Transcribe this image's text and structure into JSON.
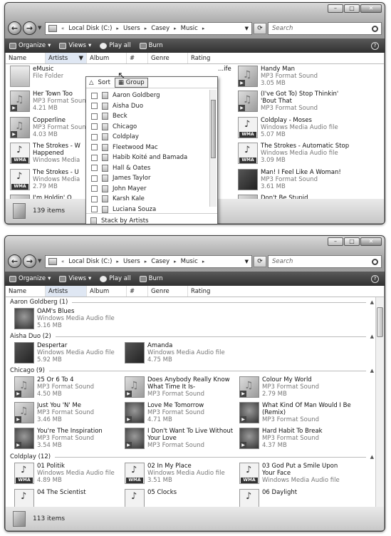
{
  "top": {
    "address": [
      "Local Disk (C:)",
      "Users",
      "Casey",
      "Music"
    ],
    "search_placeholder": "Search",
    "toolbar": {
      "organize": "Organize",
      "views": "Views",
      "play_all": "Play all",
      "burn": "Burn"
    },
    "columns": [
      "Name",
      "Artists",
      "Album",
      "#",
      "Genre",
      "Rating"
    ],
    "items": [
      {
        "name": "eMusic",
        "type": "File Folder",
        "size": "",
        "icon": "folder"
      },
      {
        "name": "Her Town Too",
        "type": "MP3 Format Sound",
        "size": "4.21 MB",
        "icon": "mp3"
      },
      {
        "name": "Copperline",
        "type": "MP3 Format Sound",
        "size": "4.03 MB",
        "icon": "mp3"
      },
      {
        "name": "The Strokes - W",
        "name2": "Happened",
        "type": "Windows Media",
        "size": "",
        "icon": "wma"
      },
      {
        "name": "The Strokes - U",
        "type": "Windows Media",
        "size": "2.79 MB",
        "icon": "wma"
      },
      {
        "name": "Handy Man",
        "type": "MP3 Format Sound",
        "size": "3.05 MB",
        "icon": "mp3"
      },
      {
        "name": "(I've Got To) Stop Thinkin'",
        "name2": "'Bout That",
        "type": "MP3 Format Sound",
        "size": "",
        "icon": "mp3"
      },
      {
        "name": "Coldplay - Moses",
        "type": "Windows Media Audio file",
        "size": "5.07 MB",
        "icon": "wma"
      },
      {
        "name": "The Strokes - Automatic Stop",
        "type": "Windows Media Audio file",
        "size": "3.09 MB",
        "icon": "wma"
      },
      {
        "name": "Man! I Feel Like A Woman!",
        "type": "MP3 Format Sound",
        "size": "3.61 MB",
        "icon": "photo"
      },
      {
        "name": "I'm Holdin' O",
        "type": "",
        "size": "",
        "icon": "mp3"
      },
      {
        "name": "...ife",
        "type": "",
        "size": "",
        "icon": ""
      },
      {
        "name": "Don't Be Stupid",
        "type": "",
        "size": "",
        "icon": "mp3"
      }
    ],
    "menu": {
      "sort": "Sort",
      "group": "Group",
      "artists": [
        "Aaron Goldberg",
        "Aisha Duo",
        "Beck",
        "Chicago",
        "Coldplay",
        "Fleetwood Mac",
        "Habib Koité and Bamada",
        "Hall & Oates",
        "James Taylor",
        "John Mayer",
        "Karsh Kale",
        "Luciana Souza"
      ],
      "stack": "Stack by Artists"
    },
    "status": "139 items"
  },
  "bottom": {
    "address": [
      "Local Disk (C:)",
      "Users",
      "Casey",
      "Music"
    ],
    "search_placeholder": "Search",
    "toolbar": {
      "organize": "Organize",
      "views": "Views",
      "play_all": "Play all",
      "burn": "Burn"
    },
    "columns": [
      "Name",
      "Artists",
      "Album",
      "#",
      "Genre",
      "Rating"
    ],
    "groups": [
      {
        "title": "Aaron Goldberg (1)"
      },
      {
        "title": "Aisha Duo (2)"
      },
      {
        "title": "Chicago (9)"
      },
      {
        "title": "Coldplay (12)"
      }
    ],
    "items": [
      {
        "name": "OAM's Blues",
        "type": "Windows Media Audio file",
        "size": "5.16 MB",
        "icon": "photo2"
      },
      {
        "name": "Despertar",
        "type": "Windows Media Audio file",
        "size": "5.92 MB",
        "icon": "photo"
      },
      {
        "name": "Amanda",
        "type": "Windows Media Audio file",
        "size": "4.75 MB",
        "icon": "photo"
      },
      {
        "name": "25 Or 6 To 4",
        "type": "MP3 Format Sound",
        "size": "4.50 MB",
        "icon": "mp3"
      },
      {
        "name": "Does Anybody Really Know",
        "name2": "What Time It Is-",
        "type": "MP3 Format Sound",
        "size": "",
        "icon": "mp3"
      },
      {
        "name": "Colour My World",
        "type": "MP3 Format Sound",
        "size": "2.79 MB",
        "icon": "mp3"
      },
      {
        "name": "Just You 'N' Me",
        "type": "MP3 Format Sound",
        "size": "3.46 MB",
        "icon": "mp3"
      },
      {
        "name": "Love Me Tomorrow",
        "type": "MP3 Format Sound",
        "size": "4.71 MB",
        "icon": "photo2"
      },
      {
        "name": "What Kind Of Man Would I Be",
        "name2": "(Remix)",
        "type": "MP3 Format Sound",
        "size": "",
        "icon": "photo2"
      },
      {
        "name": "You're The Inspiration",
        "type": "MP3 Format Sound",
        "size": "3.54 MB",
        "icon": "photo2"
      },
      {
        "name": "I Don't Want To Live Without",
        "name2": "Your Love",
        "type": "MP3 Format Sound",
        "size": "",
        "icon": "photo2"
      },
      {
        "name": "Hard Habit To Break",
        "type": "MP3 Format Sound",
        "size": "4.37 MB",
        "icon": "photo2"
      },
      {
        "name": "01 Politik",
        "type": "Windows Media Audio file",
        "size": "4.89 MB",
        "icon": "wma"
      },
      {
        "name": "02 In My Place",
        "type": "Windows Media Audio file",
        "size": "3.51 MB",
        "icon": "wma"
      },
      {
        "name": "03 God Put a Smile Upon",
        "name2": "Your Face",
        "type": "Windows Media Audio file",
        "size": "",
        "icon": "wma"
      },
      {
        "name": "04 The Scientist",
        "type": "",
        "size": "",
        "icon": "wma"
      },
      {
        "name": "05 Clocks",
        "type": "",
        "size": "",
        "icon": "wma"
      },
      {
        "name": "06 Daylight",
        "type": "",
        "size": "",
        "icon": "wma"
      }
    ],
    "status": "113 items"
  }
}
